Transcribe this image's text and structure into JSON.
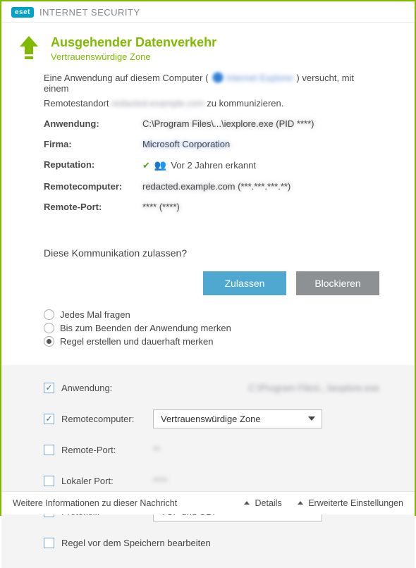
{
  "header": {
    "brand_badge": "eset",
    "brand_product": "INTERNET SECURITY"
  },
  "title": {
    "main": "Ausgehender Datenverkehr",
    "sub": "Vertrauenswürdige Zone"
  },
  "description": {
    "line1_pre": "Eine Anwendung auf diesem Computer (",
    "line1_app": "Internet Explorer",
    "line1_post": ") versucht, mit einem",
    "line2_pre": "Remotestandort ",
    "line2_host": "redacted.example.com",
    "line2_post": " zu kommunizieren."
  },
  "kv": {
    "application_label": "Anwendung:",
    "application_value": "C:\\Program Files\\...\\iexplore.exe (PID ****)",
    "company_label": "Firma:",
    "company_value": "Microsoft Corporation",
    "reputation_label": "Reputation:",
    "reputation_value": "Vor 2 Jahren erkannt",
    "remote_label": "Remotecomputer:",
    "remote_value": "redacted.example.com (***.***.***.**)",
    "port_label": "Remote-Port:",
    "port_value": "**** (****)"
  },
  "prompt": {
    "question": "Diese Kommunikation zulassen?",
    "allow": "Zulassen",
    "block": "Blockieren",
    "radio_ask": "Jedes Mal fragen",
    "radio_until_close": "Bis zum Beenden der Anwendung merken",
    "radio_create_rule": "Regel erstellen und dauerhaft merken"
  },
  "rules": {
    "application_label": "Anwendung:",
    "application_value": "C:\\Program Files\\...\\iexplore.exe",
    "remote_label": "Remotecomputer:",
    "remote_select": "Vertrauenswürdige Zone",
    "remote_port_label": "Remote-Port:",
    "remote_port_value": "**",
    "local_port_label": "Lokaler Port:",
    "local_port_value": "****",
    "protocol_label": "Protokoll:",
    "protocol_select": "TCP und UDP",
    "edit_rule_label": "Regel vor dem Speichern bearbeiten"
  },
  "footer": {
    "more_info": "Weitere Informationen zu dieser Nachricht",
    "details": "Details",
    "advanced": "Erweiterte Einstellungen"
  }
}
